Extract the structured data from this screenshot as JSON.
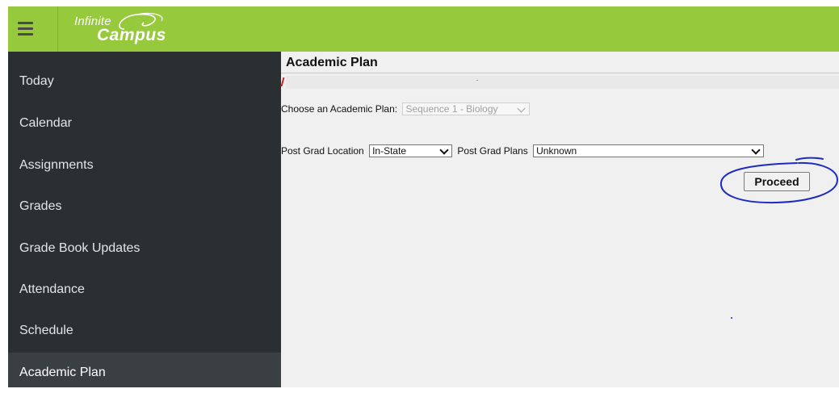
{
  "header": {
    "menu_icon": "hamburger-menu-icon",
    "logo_line1": "Infinite",
    "logo_line2": "Campus",
    "brand_color": "#97c93d"
  },
  "sidebar": {
    "items": [
      {
        "label": "Today"
      },
      {
        "label": "Calendar"
      },
      {
        "label": "Assignments"
      },
      {
        "label": "Grades"
      },
      {
        "label": "Grade Book Updates"
      },
      {
        "label": "Attendance"
      },
      {
        "label": "Schedule"
      },
      {
        "label": "Academic Plan",
        "active": true
      }
    ],
    "background": "#2b2f31"
  },
  "main": {
    "title": "Academic Plan",
    "choose_plan_label": "Choose an Academic Plan:",
    "choose_plan_value": "Sequence 1 - Biology",
    "post_grad_location_label": "Post Grad Location",
    "post_grad_location_value": "In-State",
    "post_grad_plans_label": "Post Grad Plans",
    "post_grad_plans_value": "Unknown",
    "proceed_label": "Proceed",
    "annotation_color": "#1d2bc4"
  }
}
